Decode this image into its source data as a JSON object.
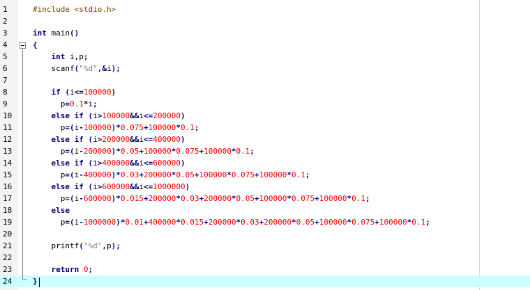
{
  "editor": {
    "lines": [
      {
        "num": "1",
        "code": "#include <stdio.h>"
      },
      {
        "num": "2",
        "code": ""
      },
      {
        "num": "3",
        "code": "int main()"
      },
      {
        "num": "4",
        "code": "{"
      },
      {
        "num": "5",
        "code": "    int i,p;"
      },
      {
        "num": "6",
        "code": "    scanf(\"%d\",&i);"
      },
      {
        "num": "7",
        "code": ""
      },
      {
        "num": "8",
        "code": "    if (i<=100000)"
      },
      {
        "num": "9",
        "code": "      p=0.1*i;"
      },
      {
        "num": "10",
        "code": "    else if (i>100000&&i<=200000)"
      },
      {
        "num": "11",
        "code": "      p=(i-100000)*0.075+100000*0.1;"
      },
      {
        "num": "12",
        "code": "    else if (i>200000&&i<=400000)"
      },
      {
        "num": "13",
        "code": "      p=(i-200000)*0.05+100000*0.075+100000*0.1;"
      },
      {
        "num": "14",
        "code": "    else if (i>400000&&i<=600000)"
      },
      {
        "num": "15",
        "code": "      p=(i-400000)*0.03+200000*0.05+100000*0.075+100000*0.1;"
      },
      {
        "num": "16",
        "code": "    else if (i>600000&&i<=1000000)"
      },
      {
        "num": "17",
        "code": "      p=(i-600000)*0.015+200000*0.03+200000*0.05+100000*0.075+100000*0.1;"
      },
      {
        "num": "18",
        "code": "    else"
      },
      {
        "num": "19",
        "code": "      p=(i-1000000)*0.01+400000*0.015+200000*0.03+200000*0.05+100000*0.075+100000*0.1;"
      },
      {
        "num": "20",
        "code": ""
      },
      {
        "num": "21",
        "code": "    printf(\"%d\",p);"
      },
      {
        "num": "22",
        "code": ""
      },
      {
        "num": "23",
        "code": "    return 0;"
      },
      {
        "num": "24",
        "code": "}"
      }
    ],
    "current_line": "24",
    "fold_icon": "fold-minus-icon",
    "colors": {
      "keyword": "#000080",
      "preprocessor": "#804000",
      "number": "#ff0000",
      "string": "#808080",
      "current_line_bg": "#ccffff"
    }
  }
}
